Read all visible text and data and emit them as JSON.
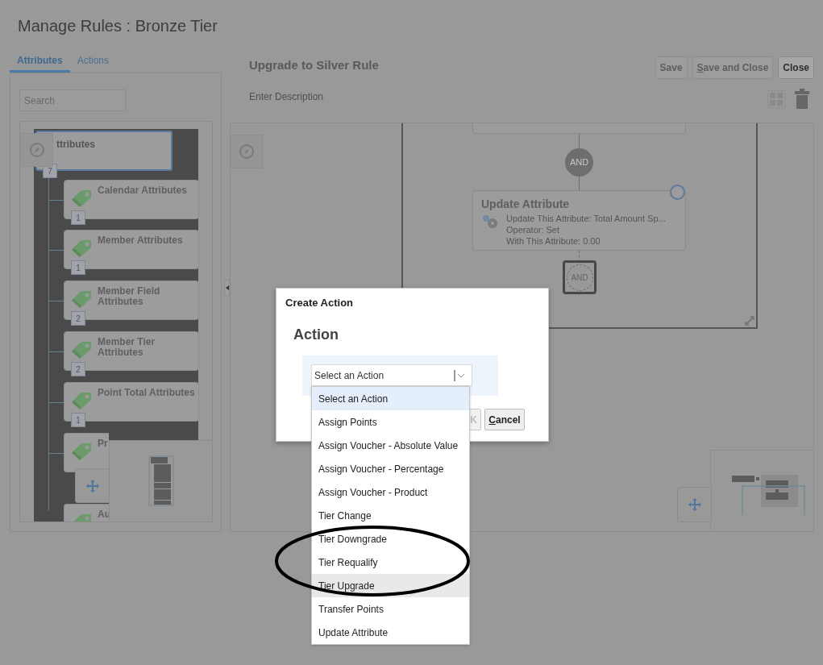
{
  "page": {
    "title": "Manage Rules : Bronze Tier"
  },
  "tabs": [
    {
      "label": "Attributes",
      "selected": true
    },
    {
      "label": "Actions",
      "selected": false
    }
  ],
  "search": {
    "placeholder": "Search"
  },
  "attribute_tree": {
    "label": "ttributes",
    "count": "7",
    "children": [
      {
        "label": "Calendar Attributes",
        "count": "1"
      },
      {
        "label": "Member Attributes",
        "count": "1"
      },
      {
        "label": "Member Field Attributes",
        "count": "2"
      },
      {
        "label": "Member Tier Attributes",
        "count": "2"
      },
      {
        "label": "Point Total Attributes",
        "count": "1"
      },
      {
        "label": "Pr"
      },
      {
        "label": "Au"
      }
    ]
  },
  "rule": {
    "title": "Upgrade to Silver Rule",
    "description": {
      "placeholder": "Enter Description"
    }
  },
  "toolbar_buttons": [
    {
      "label": "Save",
      "disabled": true,
      "underline_first": false
    },
    {
      "label": "Save and Close",
      "disabled": true,
      "underline_first": true
    },
    {
      "label": "Close",
      "disabled": false,
      "underline_first": false
    }
  ],
  "flow": {
    "connector_top": "AND",
    "action_card": {
      "title": "Update Attribute",
      "lines": [
        "Update This Attribute: Total Amount Sp...",
        "Operator: Set",
        "With This Attribute: 0.00"
      ]
    },
    "connector_bottom": "AND"
  },
  "dialog": {
    "title": "Create Action",
    "heading": "Action",
    "select": {
      "value": "Select an Action",
      "expanded": true
    },
    "options": [
      {
        "label": "Select an Action",
        "selected": true,
        "highlighted": false
      },
      {
        "label": "Assign Points",
        "selected": false,
        "highlighted": false
      },
      {
        "label": "Assign Voucher - Absolute Value",
        "selected": false,
        "highlighted": false
      },
      {
        "label": "Assign Voucher - Percentage",
        "selected": false,
        "highlighted": false
      },
      {
        "label": "Assign Voucher - Product",
        "selected": false,
        "highlighted": false
      },
      {
        "label": "Tier Change",
        "selected": false,
        "highlighted": false
      },
      {
        "label": "Tier Downgrade",
        "selected": false,
        "highlighted": false
      },
      {
        "label": "Tier Requalify",
        "selected": false,
        "highlighted": false
      },
      {
        "label": "Tier Upgrade",
        "selected": false,
        "highlighted": true
      },
      {
        "label": "Transfer Points",
        "selected": false,
        "highlighted": false
      },
      {
        "label": "Update Attribute",
        "selected": false,
        "highlighted": false
      }
    ],
    "buttons": [
      {
        "label": "K",
        "underline_first": false
      },
      {
        "label": "Cancel",
        "underline_first": true
      }
    ]
  }
}
